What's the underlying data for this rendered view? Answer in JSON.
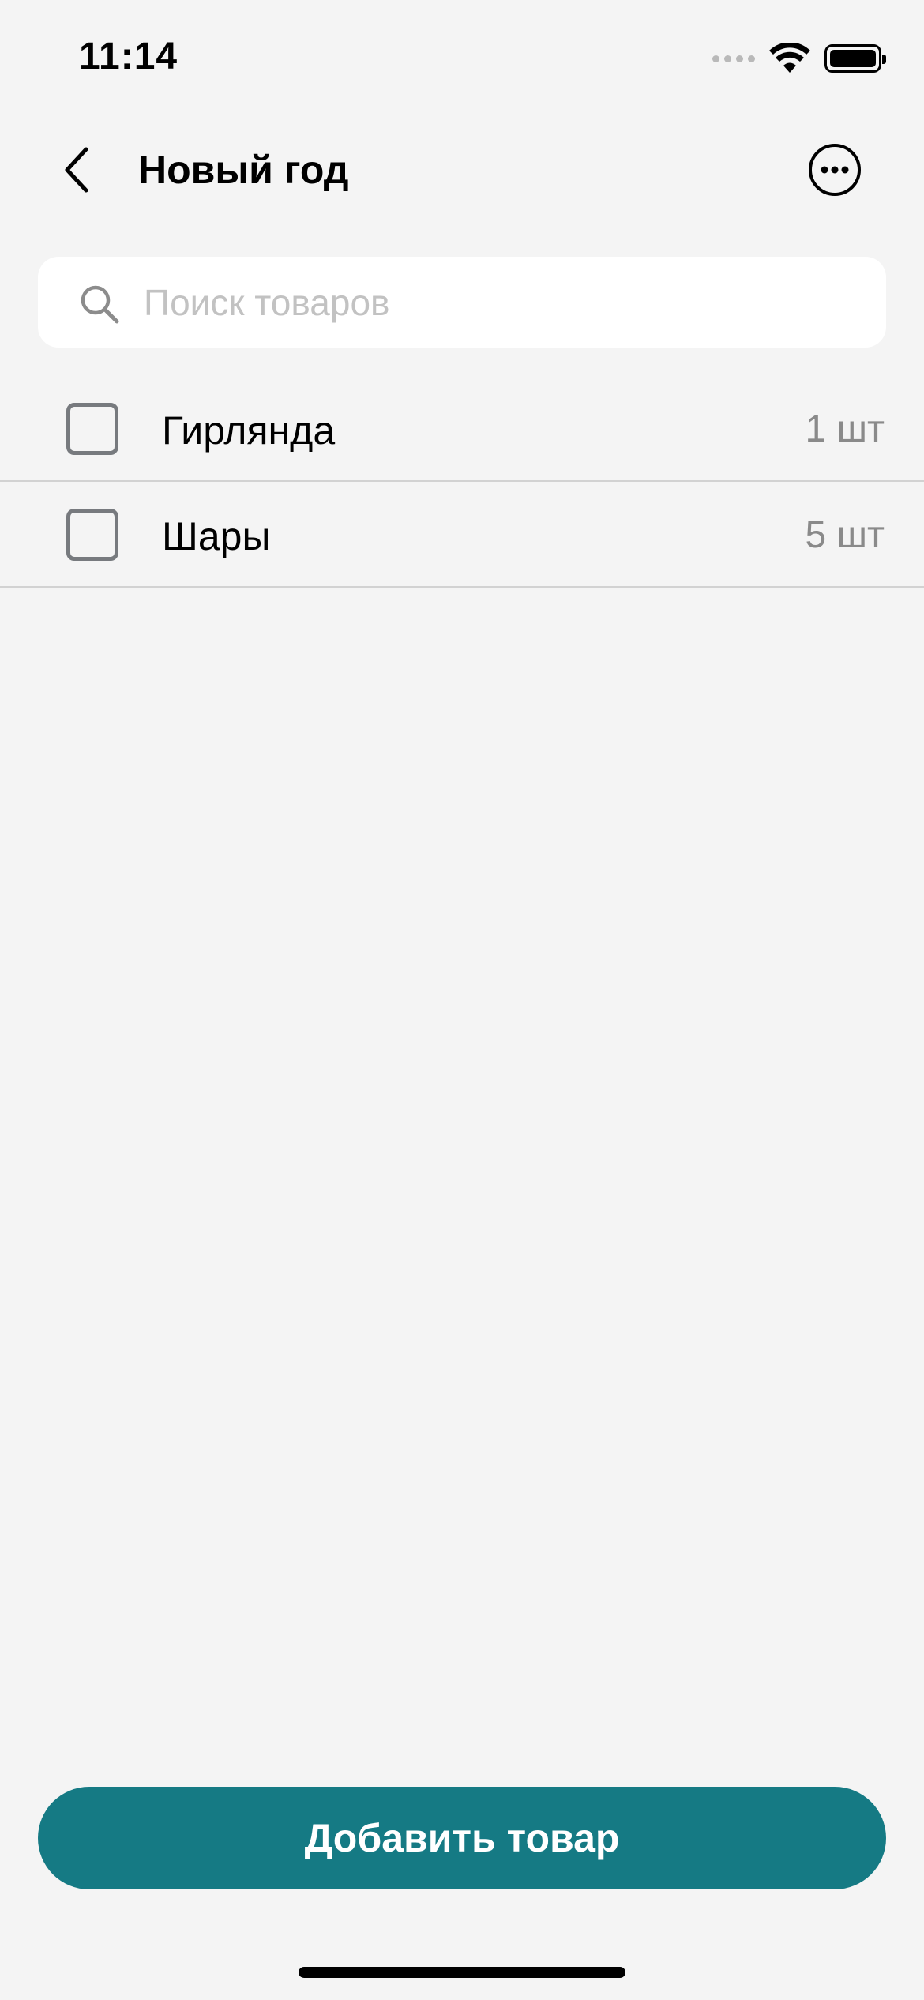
{
  "status_bar": {
    "time": "11:14",
    "icons": [
      "signal-dots-icon",
      "wifi-icon",
      "battery-icon"
    ]
  },
  "nav": {
    "title": "Новый год",
    "back_icon": "chevron-left-icon",
    "more_icon": "more-horizontal-circle-icon"
  },
  "search": {
    "placeholder": "Поиск товаров",
    "value": "",
    "icon": "search-icon"
  },
  "items": [
    {
      "name": "Гирлянда",
      "quantity": "1 шт",
      "checked": false
    },
    {
      "name": "Шары",
      "quantity": "5 шт",
      "checked": false
    }
  ],
  "actions": {
    "add_label": "Добавить товар"
  },
  "colors": {
    "background": "#f4f4f4",
    "accent": "#157a84",
    "checkbox_border": "#777a7e",
    "quantity_text": "#8a8a8a",
    "placeholder_text": "#c2c2c2"
  }
}
